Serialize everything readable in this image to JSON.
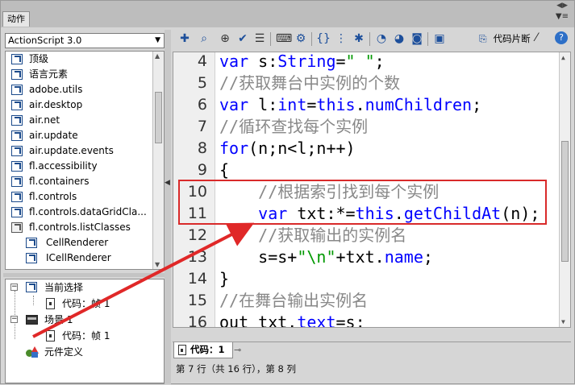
{
  "window": {
    "title_tab": "动作",
    "icons": [
      "double-arrow-icon",
      "panel-menu-icon"
    ]
  },
  "left": {
    "dropdown": "ActionScript 3.0",
    "tree_items": [
      "顶级",
      "语言元素",
      "adobe.utils",
      "air.desktop",
      "air.net",
      "air.update",
      "air.update.events",
      "fl.accessibility",
      "fl.containers",
      "fl.controls",
      "fl.controls.dataGridCla...",
      "fl.controls.listClasses",
      "CellRenderer",
      "ICellRenderer"
    ],
    "lower_tree": {
      "current": "当前选择",
      "code1": "代码：帧 1",
      "scene": "场景 1",
      "code2": "代码：帧 1",
      "symbols": "元件定义"
    }
  },
  "toolbar": {
    "snippets": "代码片断",
    "icons": [
      "add-statement-icon",
      "find-icon",
      "target-path-icon",
      "check-syntax-icon",
      "auto-format-icon",
      "show-code-hint-icon",
      "debug-options-icon",
      "collapse-braces-icon",
      "collapse-selection-icon",
      "expand-all-icon",
      "apply-block-comment-icon",
      "apply-line-comment-icon",
      "remove-comment-icon",
      "show-hide-toolbox-icon",
      "code-snippets-icon",
      "wand-icon",
      "help-icon"
    ]
  },
  "code_lines": [
    {
      "n": "4",
      "segs": [
        {
          "t": "var",
          "c": "kw"
        },
        {
          "t": " s:",
          "c": "id"
        },
        {
          "t": "String",
          "c": "kw"
        },
        {
          "t": "=",
          "c": "id"
        },
        {
          "t": "\" \"",
          "c": "st"
        },
        {
          "t": ";",
          "c": "id"
        }
      ]
    },
    {
      "n": "5",
      "segs": [
        {
          "t": "//获取舞台中实例的个数",
          "c": "cm"
        }
      ]
    },
    {
      "n": "6",
      "segs": [
        {
          "t": "var",
          "c": "kw"
        },
        {
          "t": " l:",
          "c": "id"
        },
        {
          "t": "int",
          "c": "kw"
        },
        {
          "t": "=",
          "c": "id"
        },
        {
          "t": "this",
          "c": "kw"
        },
        {
          "t": ".",
          "c": "id"
        },
        {
          "t": "numChildren",
          "c": "kw"
        },
        {
          "t": ";",
          "c": "id"
        }
      ]
    },
    {
      "n": "7",
      "segs": [
        {
          "t": "//循环查找每个实例",
          "c": "cm"
        }
      ]
    },
    {
      "n": "8",
      "segs": [
        {
          "t": "for",
          "c": "kw"
        },
        {
          "t": "(n;n<l;n++)",
          "c": "id"
        }
      ]
    },
    {
      "n": "9",
      "segs": [
        {
          "t": "{",
          "c": "id"
        }
      ]
    },
    {
      "n": "10",
      "segs": [
        {
          "t": "    //根据索引找到每个实例",
          "c": "cm"
        }
      ]
    },
    {
      "n": "11",
      "segs": [
        {
          "t": "    ",
          "c": "id"
        },
        {
          "t": "var",
          "c": "kw"
        },
        {
          "t": " txt:*=",
          "c": "id"
        },
        {
          "t": "this",
          "c": "kw"
        },
        {
          "t": ".",
          "c": "id"
        },
        {
          "t": "getChildAt",
          "c": "kw"
        },
        {
          "t": "(n);",
          "c": "id"
        }
      ]
    },
    {
      "n": "12",
      "segs": [
        {
          "t": "    //获取输出的实例名",
          "c": "cm"
        }
      ]
    },
    {
      "n": "13",
      "segs": [
        {
          "t": "    s=s+",
          "c": "id"
        },
        {
          "t": "\"\\n\"",
          "c": "st"
        },
        {
          "t": "+txt.",
          "c": "id"
        },
        {
          "t": "name",
          "c": "kw"
        },
        {
          "t": ";",
          "c": "id"
        }
      ]
    },
    {
      "n": "14",
      "segs": [
        {
          "t": "}",
          "c": "id"
        }
      ]
    },
    {
      "n": "15",
      "segs": [
        {
          "t": "//在舞台输出实例名",
          "c": "cm"
        }
      ]
    },
    {
      "n": "16",
      "segs": [
        {
          "t": "out txt.",
          "c": "id"
        },
        {
          "t": "text",
          "c": "kw"
        },
        {
          "t": "=s;",
          "c": "id"
        }
      ]
    }
  ],
  "tab": {
    "label": "代码：1"
  },
  "status": "第 7 行（共 16 行），第 8 列",
  "colors": {
    "highlight": "#d92a2a",
    "keyword": "#0000ff",
    "comment": "#888888",
    "string": "#009900"
  }
}
